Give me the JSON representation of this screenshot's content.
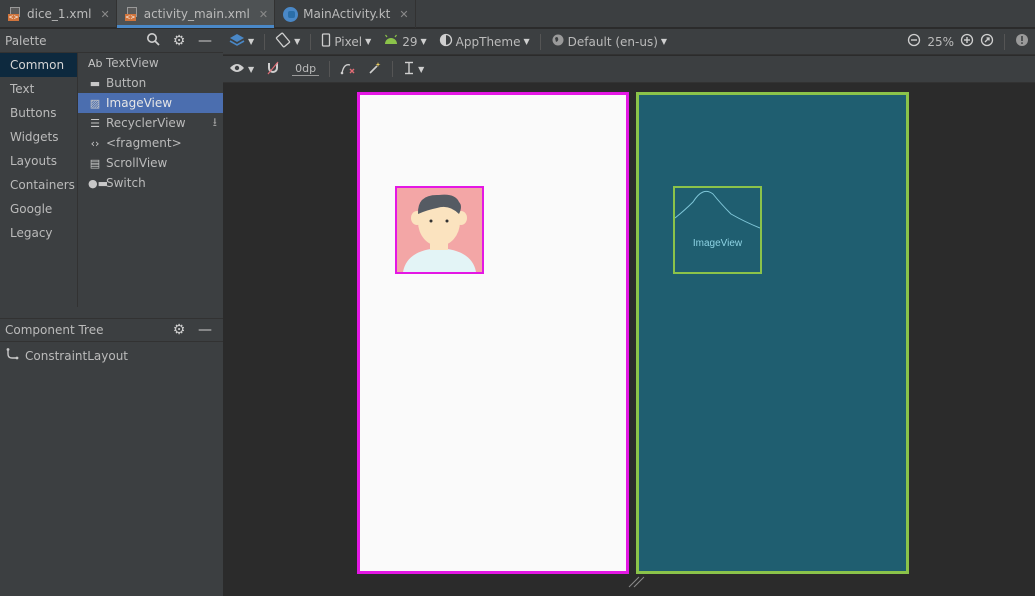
{
  "tabs": [
    {
      "label": "dice_1.xml",
      "icon": "xml-file-icon",
      "active": false
    },
    {
      "label": "activity_main.xml",
      "icon": "xml-file-icon",
      "active": true
    },
    {
      "label": "MainActivity.kt",
      "icon": "kotlin-file-icon",
      "active": false
    }
  ],
  "palette": {
    "title": "Palette",
    "categories": [
      "Common",
      "Text",
      "Buttons",
      "Widgets",
      "Layouts",
      "Containers",
      "Google",
      "Legacy"
    ],
    "selected_category": "Common",
    "widgets": [
      {
        "label": "TextView",
        "icon": "textview-icon",
        "glyph": "Ab"
      },
      {
        "label": "Button",
        "icon": "button-icon",
        "glyph": "▬"
      },
      {
        "label": "ImageView",
        "icon": "imageview-icon",
        "glyph": "▨"
      },
      {
        "label": "RecyclerView",
        "icon": "recyclerview-icon",
        "glyph": "☰"
      },
      {
        "label": "<fragment>",
        "icon": "fragment-icon",
        "glyph": "‹›"
      },
      {
        "label": "ScrollView",
        "icon": "scrollview-icon",
        "glyph": "▤"
      },
      {
        "label": "Switch",
        "icon": "switch-icon",
        "glyph": "●▬"
      }
    ],
    "selected_widget": "ImageView"
  },
  "component_tree": {
    "title": "Component Tree",
    "root": "ConstraintLayout"
  },
  "toolbar": {
    "device": "Pixel",
    "api_level": "29",
    "theme": "AppTheme",
    "locale": "Default (en-us)",
    "zoom": "25%",
    "margin": "0dp"
  },
  "canvas": {
    "blueprint_label": "ImageView"
  },
  "colors": {
    "selection_border": "#e417e4",
    "blueprint_border": "#8bc34a",
    "blueprint_bg": "#1f5e70",
    "selected_item": "#4b6eaf"
  }
}
